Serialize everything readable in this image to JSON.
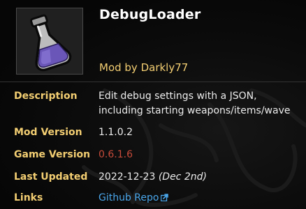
{
  "mod": {
    "name": "DebugLoader",
    "author": "Mod by Darkly77",
    "thumbnail_icon": "potion-flask-icon"
  },
  "details": {
    "description": {
      "label": "Description",
      "line1": "Edit debug settings with a JSON,",
      "line2": "including starting weapons/items/wave"
    },
    "mod_version": {
      "label": "Mod Version",
      "value": "1.1.0.2"
    },
    "game_version": {
      "label": "Game Version",
      "value": "0.6.1.6",
      "color": "#c84b3a"
    },
    "last_updated": {
      "label": "Last Updated",
      "date": "2022-12-23",
      "relative": "(Dec 2nd)"
    },
    "links": {
      "label": "Links",
      "link_text": "Github Repo",
      "icon": "external-link-icon"
    }
  },
  "colors": {
    "label": "#f3ce72",
    "link": "#4aa6ea",
    "background": "#0c0c0c"
  }
}
